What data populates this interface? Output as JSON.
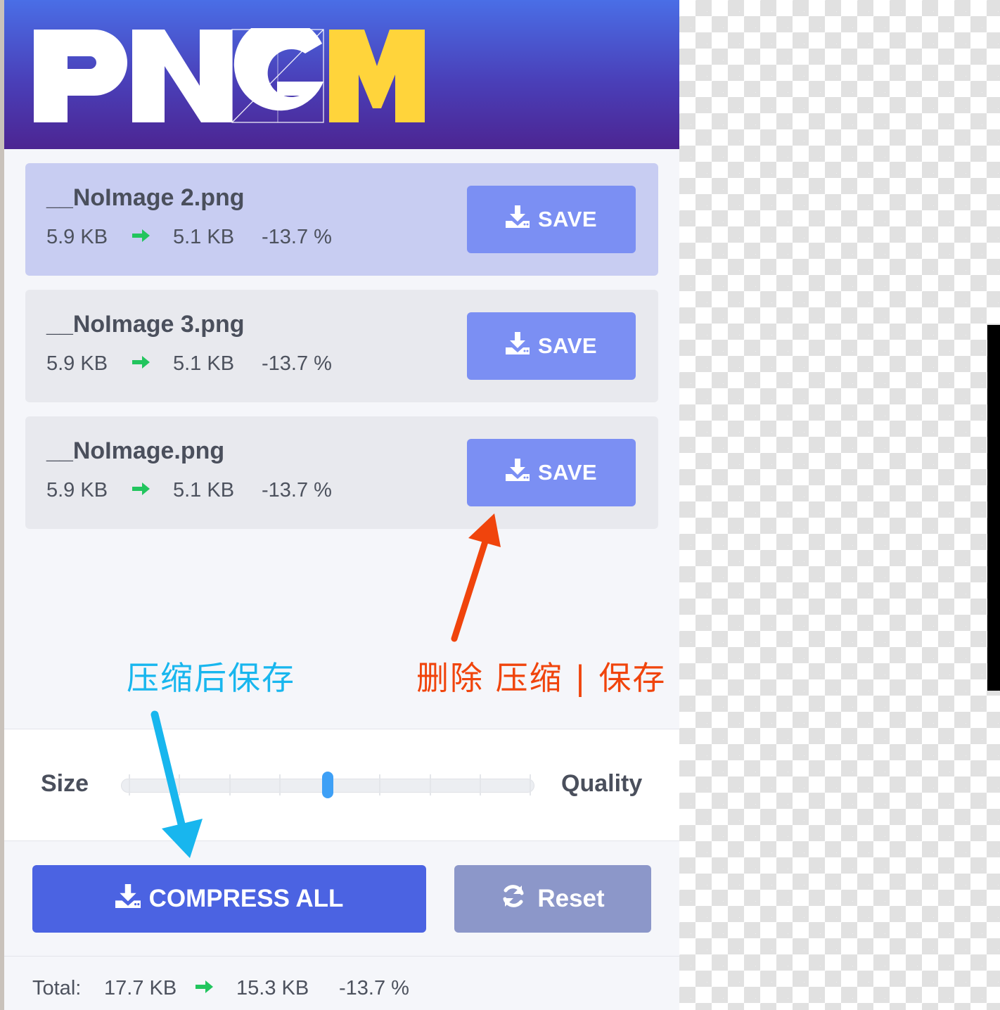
{
  "app": {
    "logo_text": "PNGM",
    "logo_colors": {
      "white": "#ffffff",
      "accent": "#ffd43b"
    }
  },
  "files": [
    {
      "name": "__NoImage 2.png",
      "original_size": "5.9 KB",
      "compressed_size": "5.1 KB",
      "ratio": "-13.7 %",
      "save_label": "SAVE",
      "selected": true
    },
    {
      "name": "__NoImage 3.png",
      "original_size": "5.9 KB",
      "compressed_size": "5.1 KB",
      "ratio": "-13.7 %",
      "save_label": "SAVE",
      "selected": false
    },
    {
      "name": "__NoImage.png",
      "original_size": "5.9 KB",
      "compressed_size": "5.1 KB",
      "ratio": "-13.7 %",
      "save_label": "SAVE",
      "selected": false
    }
  ],
  "annotations": {
    "compress_save": "压缩后保存",
    "delete_compress_save": "删除 压缩 | 保存"
  },
  "settings": {
    "size_label": "Size",
    "quality_label": "Quality",
    "slider_ticks": 9,
    "slider_value_fraction": 0.5
  },
  "actions": {
    "compress_all_label": "COMPRESS ALL",
    "reset_label": "Reset"
  },
  "total": {
    "label": "Total:",
    "original_size": "17.7 KB",
    "compressed_size": "15.3 KB",
    "ratio": "-13.7 %"
  },
  "colors": {
    "header_top": "#4a6ee6",
    "header_bottom": "#4c2592",
    "save_button": "#7b8ff3",
    "compress_button": "#4b63e2",
    "reset_button": "#8c97c9",
    "arrow_green": "#22c55e",
    "annotation_blue": "#18b6ee",
    "annotation_red": "#f0440c",
    "slider_thumb": "#3ea0f6"
  },
  "icons": {
    "save": "download-icon",
    "arrow": "arrow-right-icon",
    "reset": "refresh-icon"
  }
}
